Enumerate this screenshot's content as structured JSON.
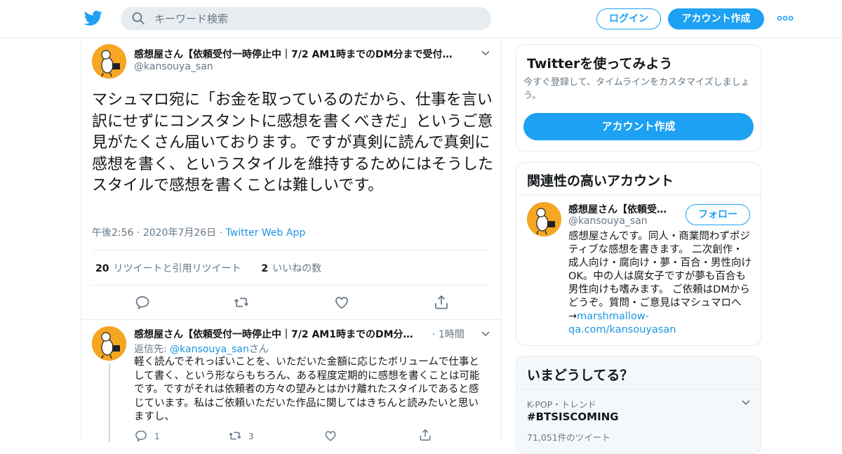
{
  "colors": {
    "brand": "#1da1f2",
    "link": "#1b95e0",
    "muted": "#657786",
    "text": "#14171a",
    "avatar_bg": "#f5a623"
  },
  "header": {
    "search_placeholder": "キーワード検索",
    "login_label": "ログイン",
    "signup_label": "アカウント作成"
  },
  "tweet": {
    "author_name": "感想屋さん【依頼受付一時停止中｜7/2 AM1時までのDM分まで受付…",
    "author_handle": "@kansouya_san",
    "text": "マシュマロ宛に「お金を取っているのだから、仕事を言い訳にせずにコンスタントに感想を書くべきだ」というご意見がたくさん届いております。ですが真剣に読んで真剣に感想を書く、というスタイルを維持するためにはそうしたスタイルで感想を書くことは難しいです。",
    "time": "午後2:56",
    "date": "2020年7月26日",
    "source": "Twitter Web App",
    "retweet_count": "20",
    "retweet_label": "リツイートと引用リツイート",
    "like_count": "2",
    "like_label": "いいねの数"
  },
  "reply": {
    "author_name": "感想屋さん【依頼受付一時停止中｜7/2 AM1時までのDM分…",
    "time": "1時間",
    "reply_to_prefix": "返信先: ",
    "reply_to_handle": "@kansouya_san",
    "reply_to_suffix": "さん",
    "text": "軽く読んでそれっぽいことを、いただいた金額に応じたボリュームで仕事として書く、という形ならもちろん、ある程度定期的に感想を書くことは可能です。ですがそれは依頼者の方々の望みとはかけ離れたスタイルであると感じています。私はご依頼いただいた作品に関してはきちんと読みたいと思いますし、",
    "reply_count": "1",
    "retweet_count": "3"
  },
  "signup_card": {
    "title": "Twitterを使ってみよう",
    "subtitle": "今すぐ登録して、タイムラインをカスタマイズしましょう。",
    "button": "アカウント作成"
  },
  "related": {
    "title": "関連性の高いアカウント",
    "name": "感想屋さん【依頼受…",
    "handle": "@kansouya_san",
    "follow_label": "フォロー",
    "bio": "感想屋さんです。同人・商業問わずポジティブな感想を書きます。 二次創作・成人向け・腐向け・夢・百合・男性向けOK。中の人は腐女子ですが夢も百合も男性向けも嗜みます。 ご依頼はDMからどうぞ。質問・ご意見はマシュマロへ→",
    "bio_link": "marshmallow-qa.com/kansouyasan"
  },
  "trends": {
    "title": "いまどうしてる？",
    "meta": "K-POP・トレンド",
    "name": "#BTSISCOMING",
    "count": "71,051件のツイート"
  }
}
